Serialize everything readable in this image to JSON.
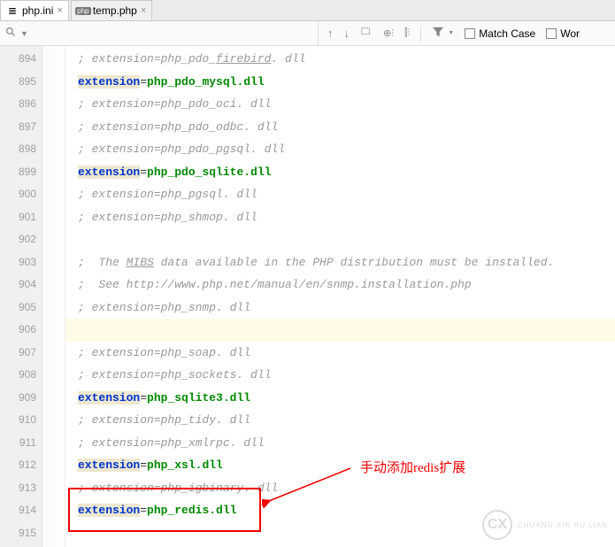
{
  "tabs": [
    {
      "label": "php.ini",
      "icon": "≣"
    },
    {
      "label": "temp.php",
      "icon": "php"
    }
  ],
  "toolbar": {
    "match_case": "Match Case",
    "words": "Wor"
  },
  "gutter_start": 894,
  "lines": [
    {
      "type": "comment",
      "prefix": "; ",
      "k": "extension",
      "eq": "=",
      "v": "php_pdo_",
      "u": "firebird",
      "r": ". dll"
    },
    {
      "type": "active",
      "k": "extension",
      "eq": "=",
      "v": "php_pdo_mysql.dll"
    },
    {
      "type": "comment",
      "prefix": "; ",
      "k": "extension",
      "eq": "=",
      "v": "php_pdo_oci. dll"
    },
    {
      "type": "comment",
      "prefix": "; ",
      "k": "extension",
      "eq": "=",
      "v": "php_pdo_odbc. dll"
    },
    {
      "type": "comment",
      "prefix": "; ",
      "k": "extension",
      "eq": "=",
      "v": "php_pdo_pgsql. dll"
    },
    {
      "type": "active",
      "k": "extension",
      "eq": "=",
      "v": "php_pdo_sqlite.dll"
    },
    {
      "type": "comment",
      "prefix": "; ",
      "k": "extension",
      "eq": "=",
      "v": "php_pgsql. dll"
    },
    {
      "type": "comment",
      "prefix": "; ",
      "k": "extension",
      "eq": "=",
      "v": "php_shmop. dll"
    },
    {
      "type": "blank"
    },
    {
      "type": "text",
      "t": ";  The ",
      "u": "MIBS",
      "r": " data available in the PHP distribution must be installed."
    },
    {
      "type": "plaincmt",
      "t": ";  See http://www.php.net/manual/en/snmp.installation.php"
    },
    {
      "type": "comment",
      "prefix": "; ",
      "k": "extension",
      "eq": "=",
      "v": "php_snmp. dll"
    },
    {
      "type": "cursor"
    },
    {
      "type": "comment",
      "prefix": "; ",
      "k": "extension",
      "eq": "=",
      "v": "php_soap. dll"
    },
    {
      "type": "comment",
      "prefix": "; ",
      "k": "extension",
      "eq": "=",
      "v": "php_sockets. dll"
    },
    {
      "type": "active",
      "k": "extension",
      "eq": "=",
      "v": "php_sqlite3.dll"
    },
    {
      "type": "comment",
      "prefix": "; ",
      "k": "extension",
      "eq": "=",
      "v": "php_tidy. dll"
    },
    {
      "type": "comment",
      "prefix": "; ",
      "k": "extension",
      "eq": "=",
      "v": "php_xmlrpc. dll"
    },
    {
      "type": "active",
      "k": "extension",
      "eq": "=",
      "v": "php_xsl.dll"
    },
    {
      "type": "comment",
      "prefix": "; ",
      "k": "extension",
      "eq": "=",
      "v": "php_igbinary. dll"
    },
    {
      "type": "active",
      "k": "extension",
      "eq": "=",
      "v": "php_redis.dll"
    },
    {
      "type": "blank"
    }
  ],
  "annotation": "手动添加redis扩展",
  "watermark": {
    "initials": "CX",
    "text": "CHUANG XIN HU LIAN"
  }
}
